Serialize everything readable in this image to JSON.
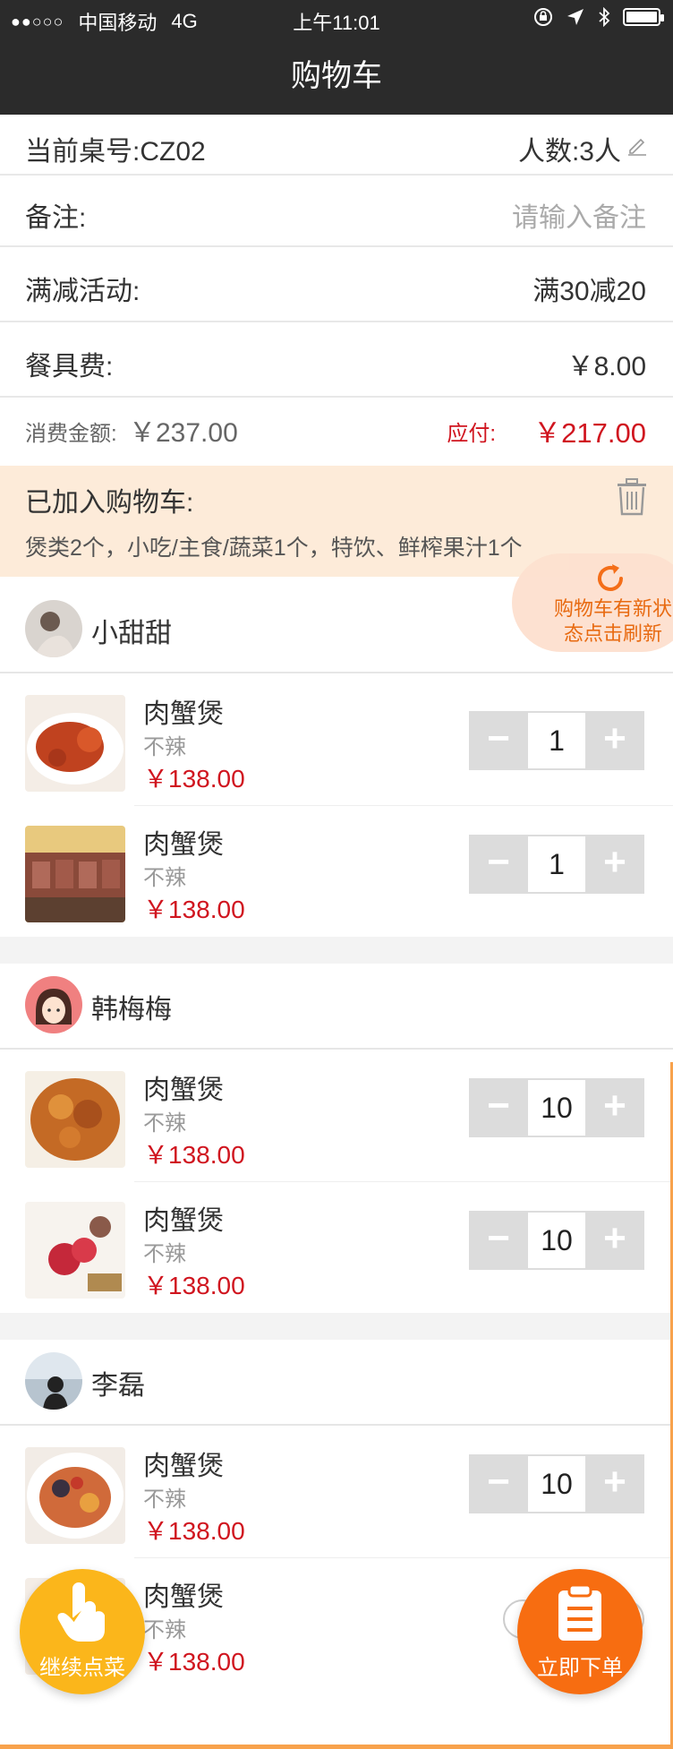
{
  "status_bar": {
    "signal_dots": "●●○○○",
    "carrier": "中国移动",
    "network": "4G",
    "time": "上午11:01"
  },
  "nav": {
    "title": "购物车"
  },
  "info": {
    "table_label": "当前桌号:CZ02",
    "people_label": "人数:3人",
    "note_label": "备注:",
    "note_placeholder": "请输入备注",
    "promo_label": "满减活动:",
    "promo_value": "满30减20",
    "tableware_label": "餐具费:",
    "tableware_value": "￥8.00",
    "consume_label": "消费金额:",
    "consume_value": "￥237.00",
    "payable_label": "应付:",
    "payable_value": "￥217.00"
  },
  "added": {
    "title": "已加入购物车:",
    "summary": "煲类2个，小吃/主食/蔬菜1个，特饮、鲜榨果汁1个"
  },
  "refresh_tip": {
    "line1": "购物车有新状",
    "line2": "态点击刷新"
  },
  "groups": [
    {
      "user": "小甜甜",
      "items": [
        {
          "name": "肉蟹煲",
          "option": "不辣",
          "price": "￥138.00",
          "qty": "1"
        },
        {
          "name": "肉蟹煲",
          "option": "不辣",
          "price": "￥138.00",
          "qty": "1"
        }
      ]
    },
    {
      "user": "韩梅梅",
      "items": [
        {
          "name": "肉蟹煲",
          "option": "不辣",
          "price": "￥138.00",
          "qty": "10"
        },
        {
          "name": "肉蟹煲",
          "option": "不辣",
          "price": "￥138.00",
          "qty": "10"
        }
      ]
    },
    {
      "user": "李磊",
      "items": [
        {
          "name": "肉蟹煲",
          "option": "不辣",
          "price": "￥138.00",
          "qty": "10"
        },
        {
          "name": "肉蟹煲",
          "option": "不辣",
          "price": "￥138.00",
          "qty": ""
        }
      ]
    }
  ],
  "stepper": {
    "minus": "−",
    "plus": "+"
  },
  "actions": {
    "continue_label": "继续点菜",
    "order_label": "立即下单"
  },
  "colors": {
    "accent_red": "#d0151f",
    "orange": "#f76d11",
    "yellow": "#fbb61b",
    "nav_bg": "#2b2b2b"
  }
}
